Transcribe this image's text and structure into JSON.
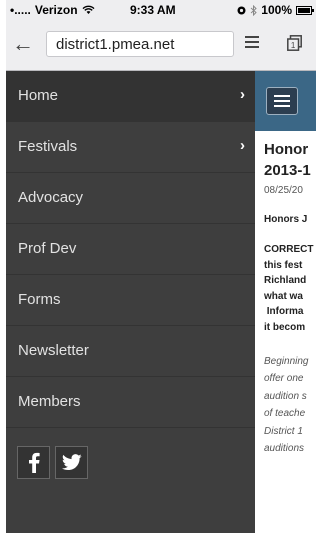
{
  "status_bar": {
    "carrier": "Verizon",
    "time": "9:33 AM",
    "battery": "100%"
  },
  "browser": {
    "url": "district1.pmea.net"
  },
  "nav": {
    "items": [
      {
        "label": "Home",
        "has_chevron": true
      },
      {
        "label": "Festivals",
        "has_chevron": true
      },
      {
        "label": "Advocacy",
        "has_chevron": false
      },
      {
        "label": "Prof Dev",
        "has_chevron": false
      },
      {
        "label": "Forms",
        "has_chevron": false
      },
      {
        "label": "Newsletter",
        "has_chevron": false
      },
      {
        "label": "Members",
        "has_chevron": false
      }
    ],
    "chevron": "›",
    "social": [
      "facebook",
      "twitter"
    ]
  },
  "content": {
    "title_lines": [
      "Honor",
      "2013-1"
    ],
    "date": "08/25/20",
    "subhead": "Honors J",
    "correction_lines": [
      "CORRECT",
      "this fest",
      "Richland",
      "what wa",
      " Informa",
      "it becom"
    ],
    "intro_lines": [
      "Beginning",
      "offer one",
      "audition s",
      "of teache",
      "District 1",
      "auditions"
    ]
  },
  "colors": {
    "nav_bg": "#3e3e3e",
    "header_bg": "#3b6786",
    "browser_bar_bg": "#eeeef0"
  }
}
